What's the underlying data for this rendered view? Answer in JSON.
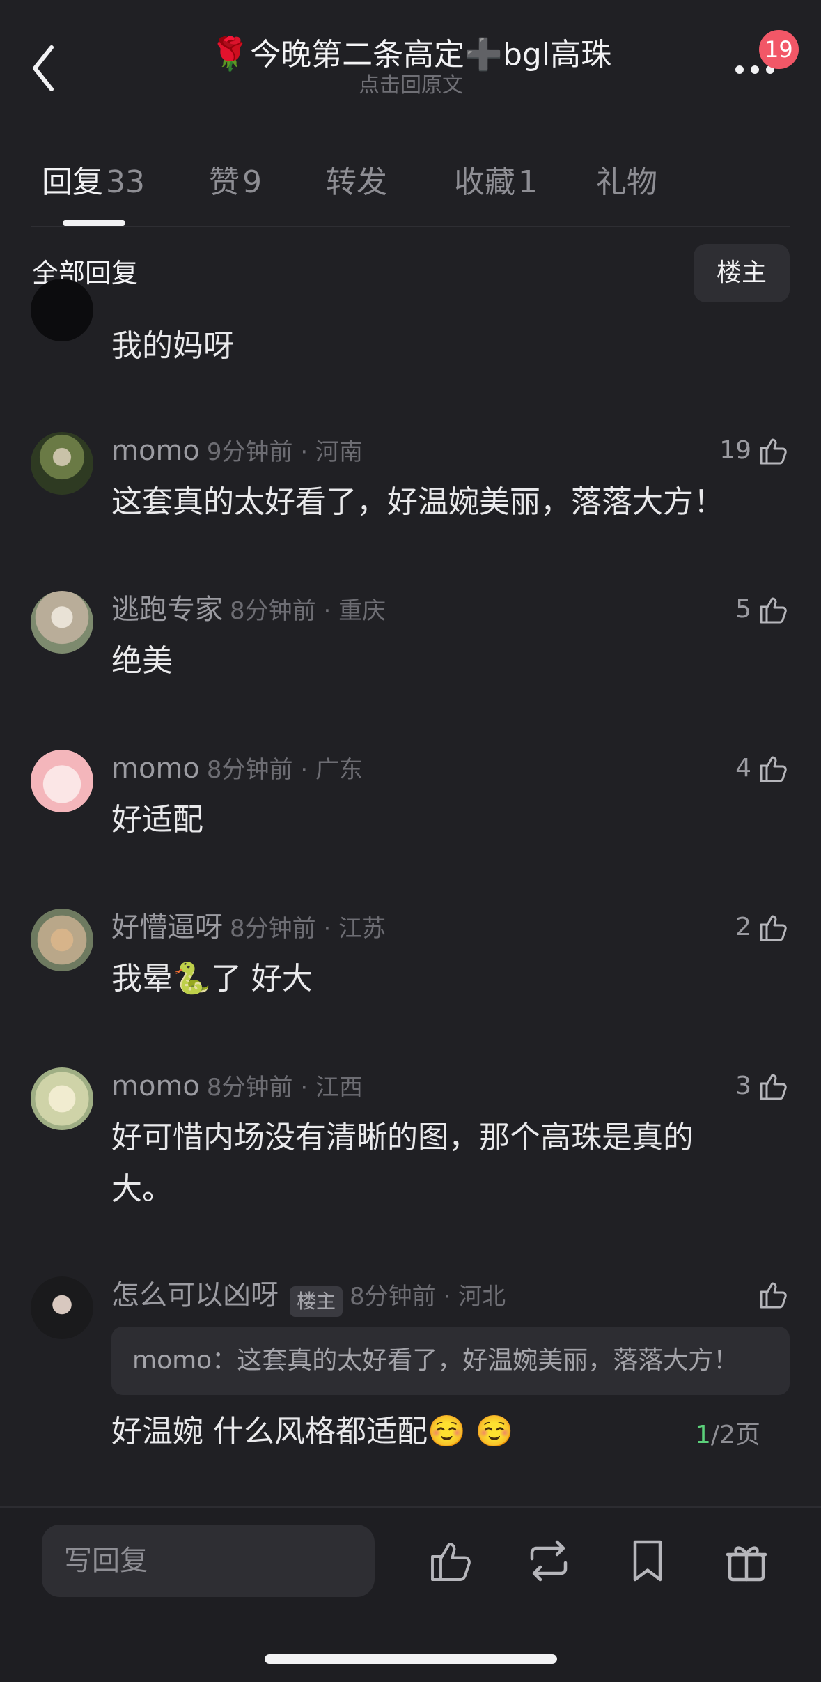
{
  "header": {
    "title_emoji": "🌹",
    "title_text": "今晚第二条高定",
    "title_plus": "➕",
    "title_text2": "bgl高珠",
    "subtitle": "点击回原文",
    "notification_badge": "19"
  },
  "tabs": [
    {
      "label": "回复",
      "count": "33",
      "active": true
    },
    {
      "label": "赞",
      "count": "9",
      "active": false
    },
    {
      "label": "转发",
      "count": "",
      "active": false
    },
    {
      "label": "收藏",
      "count": "1",
      "active": false
    },
    {
      "label": "礼物",
      "count": "",
      "active": false
    }
  ],
  "section": {
    "title": "全部回复",
    "owner_filter": "楼主"
  },
  "comments": [
    {
      "content": "我的妈呀"
    },
    {
      "name": "momo",
      "time": "9分钟前",
      "region": "河南",
      "likes": "19",
      "content": "这套真的太好看了，好温婉美丽，落落大方！"
    },
    {
      "name": "逃跑专家",
      "time": "8分钟前",
      "region": "重庆",
      "likes": "5",
      "content": "绝美"
    },
    {
      "name": "momo",
      "time": "8分钟前",
      "region": "广东",
      "likes": "4",
      "content": "好适配"
    },
    {
      "name": "好懵逼呀",
      "time": "8分钟前",
      "region": "江苏",
      "likes": "2",
      "content_a": "我晕",
      "content_emoji": "🐍",
      "content_b": "了 好大"
    },
    {
      "name": "momo",
      "time": "8分钟前",
      "region": "江西",
      "likes": "3",
      "content_line1": "好可惜内场没有清晰的图，那个高珠是真的",
      "content_line2": "大。"
    },
    {
      "name": "怎么可以凶呀",
      "owner_tag": "楼主",
      "time": "8分钟前",
      "region": "河北",
      "likes": "",
      "quote": "momo：这套真的太好看了，好温婉美丽，落落大方！",
      "content": "好温婉 什么风格都适配☺️ ☺️"
    }
  ],
  "pager": {
    "current": "1",
    "total": "/2页"
  },
  "bottom_bar": {
    "reply_placeholder": "写回复"
  },
  "icons": [
    "back-icon",
    "more-icon",
    "thumbs-up-icon",
    "repost-icon",
    "bookmark-icon",
    "gift-icon"
  ],
  "colors": {
    "background": "#202024",
    "badge": "#f25767",
    "pager_current": "#5bd07a"
  }
}
